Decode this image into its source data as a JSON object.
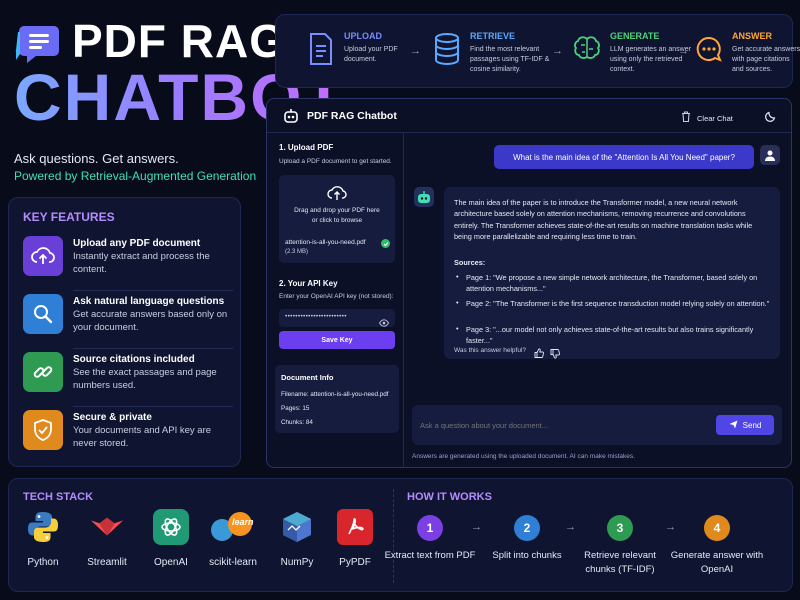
{
  "hero": {
    "title_line1": "PDF RAG",
    "title_line2": "CHATBOT",
    "tagline": "Ask questions. Get answers.",
    "powered_by": "Powered by Retrieval-Augmented Generation"
  },
  "features": {
    "heading": "KEY FEATURES",
    "items": [
      {
        "title": "Upload any PDF document",
        "desc": "Instantly extract and process the content.",
        "icon": "cloud-upload-icon",
        "color": "#6a3fd8"
      },
      {
        "title": "Ask natural language questions",
        "desc": "Get accurate answers based only on your document.",
        "icon": "search-icon",
        "color": "#2f7fd6"
      },
      {
        "title": "Source citations included",
        "desc": "See the exact passages and page numbers used.",
        "icon": "link-icon",
        "color": "#2f9a52"
      },
      {
        "title": "Secure & private",
        "desc": "Your documents and API key are never stored.",
        "icon": "shield-check-icon",
        "color": "#e08a1e"
      }
    ]
  },
  "pipeline": [
    {
      "title": "UPLOAD",
      "desc": "Upload your PDF document.",
      "color": "#7a8cff",
      "icon": "document-icon"
    },
    {
      "title": "RETRIEVE",
      "desc": "Find the most relevant passages using TF-IDF & cosine similarity.",
      "color": "#5aa8ff",
      "icon": "database-icon"
    },
    {
      "title": "GENERATE",
      "desc": "LLM generates an answer using only the retrieved context.",
      "color": "#4cd37a",
      "icon": "brain-icon"
    },
    {
      "title": "ANSWER",
      "desc": "Get accurate answers with page citations and sources.",
      "color": "#ffa53a",
      "icon": "chat-bubble-icon"
    }
  ],
  "chat": {
    "title": "PDF RAG Chatbot",
    "clear_label": "Clear Chat",
    "upload": {
      "heading": "1. Upload PDF",
      "desc": "Upload a PDF document to get started.",
      "drop_line1": "Drag and drop your PDF here",
      "drop_line2": "or click to browse",
      "filename": "attention-is-all-you-need.pdf",
      "filesize": "(2.3 MB)"
    },
    "api": {
      "heading": "2. Your API Key",
      "desc": "Enter your OpenAI API key (not stored):",
      "value": "••••••••••••••••••••••••",
      "save_label": "Save Key"
    },
    "docinfo": {
      "heading": "Document Info",
      "filename": "Filename: attention-is-all-you-need.pdf",
      "pages": "Pages: 15",
      "chunks": "Chunks: 84"
    },
    "user_message": "What is the main idea of the \"Attention Is All You Need\" paper?",
    "bot_answer": "The main idea of the paper is to introduce the Transformer model, a new neural network architecture based solely on attention mechanisms, removing recurrence and convolutions entirely. The Transformer achieves state-of-the-art results on machine translation tasks while being more parallelizable and requiring less time to train.",
    "sources_label": "Sources:",
    "sources": [
      "Page 1: \"We propose a new simple network architecture, the Transformer, based solely on attention mechanisms...\"",
      "Page 2: \"The Transformer is the first sequence transduction model relying solely on attention.\"",
      "Page 3: \"...our model not only achieves state-of-the-art results but also trains significantly faster...\""
    ],
    "helpful": "Was this answer helpful?",
    "input_placeholder": "Ask a question about your document...",
    "send_label": "Send",
    "disclaimer": "Answers are generated using the uploaded document. AI can make mistakes."
  },
  "tech_stack": {
    "heading": "TECH STACK",
    "items": [
      {
        "label": "Python",
        "icon": "python-icon"
      },
      {
        "label": "Streamlit",
        "icon": "streamlit-icon"
      },
      {
        "label": "OpenAI",
        "icon": "openai-icon"
      },
      {
        "label": "scikit-learn",
        "icon": "scikit-learn-icon",
        "badge": "learn"
      },
      {
        "label": "NumPy",
        "icon": "numpy-icon"
      },
      {
        "label": "PyPDF",
        "icon": "pypdf-icon"
      }
    ]
  },
  "how_it_works": {
    "heading": "HOW IT WORKS",
    "steps": [
      {
        "num": "1",
        "label": "Extract text from PDF",
        "color": "#7b3fe4"
      },
      {
        "num": "2",
        "label": "Split into chunks",
        "color": "#2f7fd6"
      },
      {
        "num": "3",
        "label": "Retrieve relevant chunks (TF-IDF)",
        "color": "#2f9a52"
      },
      {
        "num": "4",
        "label": "Generate answer with OpenAI",
        "color": "#e08a1e"
      }
    ]
  }
}
